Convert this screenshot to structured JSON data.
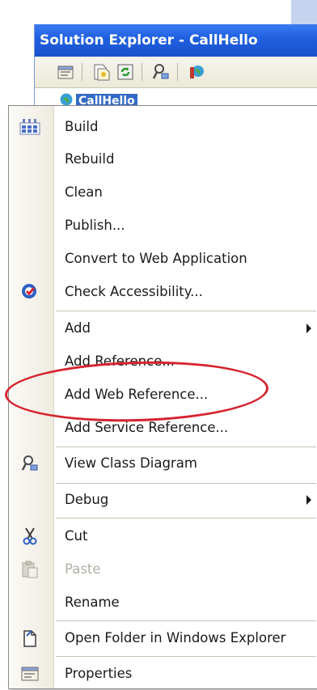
{
  "solution_explorer": {
    "title": "Solution Explorer - CallHello",
    "toolbar_icons": [
      "properties-icon",
      "show-all-files-icon",
      "refresh-icon",
      "view-class-diagram-icon",
      "web-project-icon"
    ],
    "selected_node": {
      "label": "CallHello",
      "icon": "web-project-icon"
    },
    "colors": {
      "titlebar": "#1f5fe0",
      "selection": "#316ac5"
    }
  },
  "context_menu": {
    "items": [
      {
        "label": "Build",
        "icon": "build-icon"
      },
      {
        "label": "Rebuild"
      },
      {
        "label": "Clean"
      },
      {
        "label": "Publish..."
      },
      {
        "label": "Convert to Web Application"
      },
      {
        "label": "Check Accessibility...",
        "icon": "accessibility-icon"
      },
      {
        "label": "Add",
        "submenu": true
      },
      {
        "label": "Add Reference..."
      },
      {
        "label": "Add Web Reference...",
        "highlighted": true
      },
      {
        "label": "Add Service Reference..."
      },
      {
        "label": "View Class Diagram",
        "icon": "view-class-diagram-icon"
      },
      {
        "label": "Debug",
        "submenu": true
      },
      {
        "label": "Cut",
        "icon": "cut-icon"
      },
      {
        "label": "Paste",
        "icon": "paste-icon",
        "disabled": true
      },
      {
        "label": "Rename"
      },
      {
        "label": "Open Folder in Windows Explorer",
        "icon": "open-folder-icon"
      },
      {
        "label": "Properties",
        "icon": "properties-icon"
      }
    ]
  },
  "annotation": {
    "target": "Add Web Reference...",
    "color": "#d6232e"
  }
}
